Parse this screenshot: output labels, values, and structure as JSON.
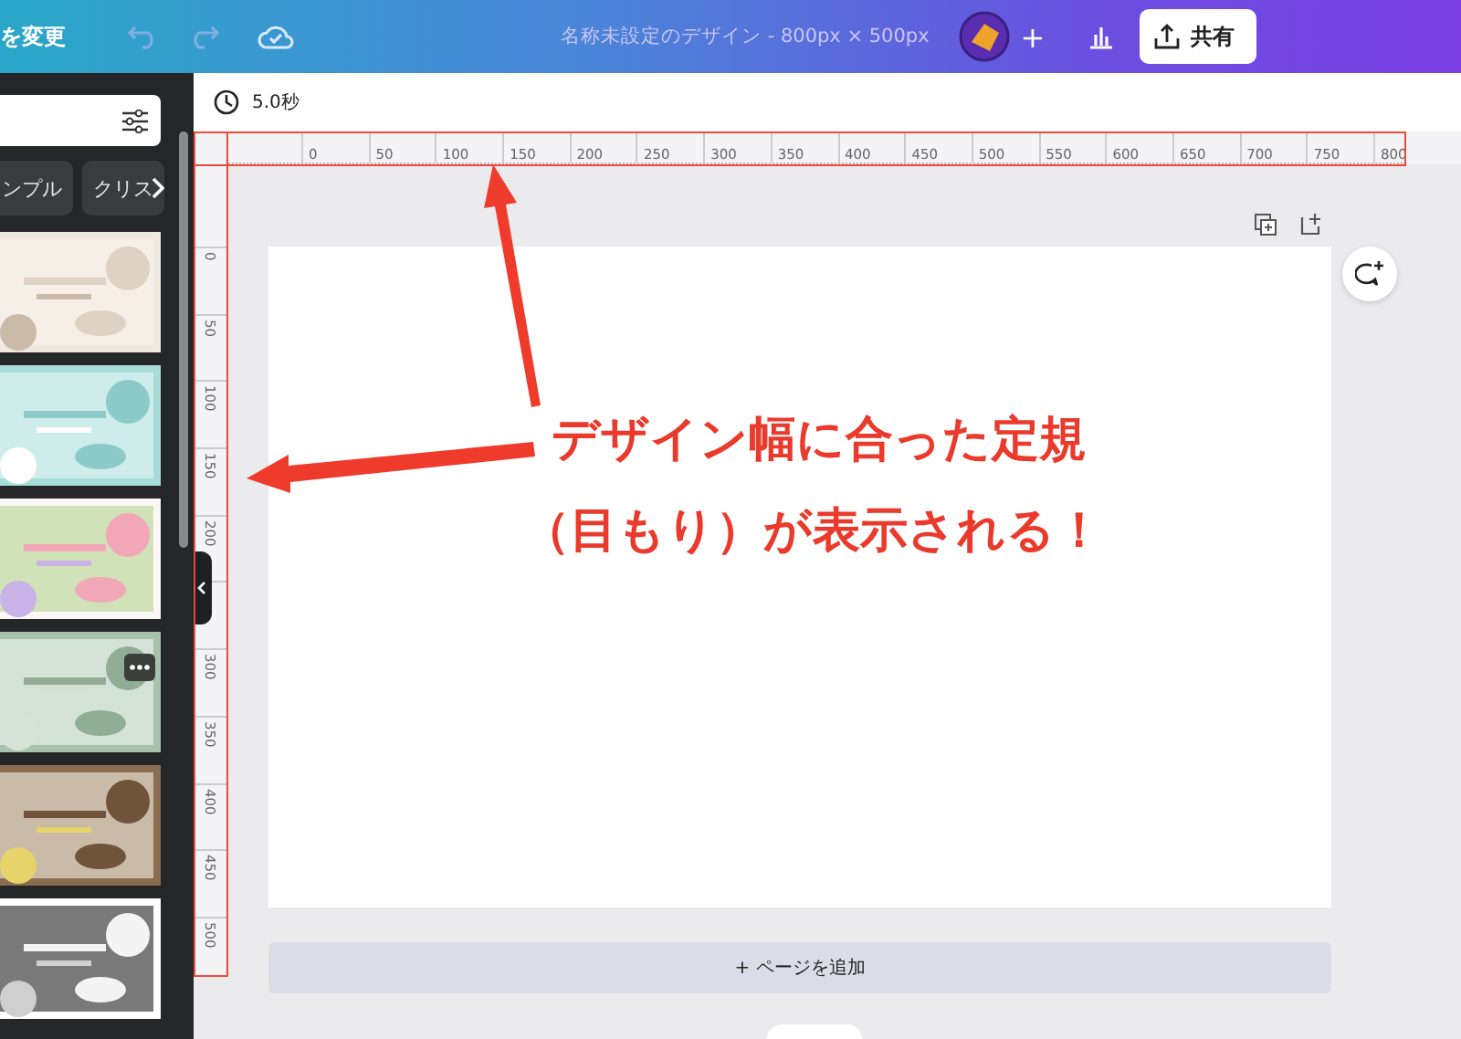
{
  "toolbar": {
    "menu_text": "を変更",
    "title": "名称未設定のデザイン - 800px × 500px",
    "add_button": "+",
    "share_button": "共有"
  },
  "side_panel": {
    "chips": [
      {
        "label": "ンプル"
      },
      {
        "label": "クリス"
      }
    ]
  },
  "timing": "5.0秒",
  "horizontal_ruler": {
    "labels": [
      "0",
      "50",
      "100",
      "150",
      "200",
      "250",
      "300",
      "350",
      "400",
      "450",
      "500",
      "550",
      "600",
      "650",
      "700",
      "750",
      "800"
    ]
  },
  "vertical_ruler": {
    "labels_above_handle": [
      "0",
      "50",
      "100",
      "150",
      "200"
    ],
    "labels_below_handle": [
      "300",
      "350",
      "400",
      "450",
      "500"
    ]
  },
  "add_page_button": "+ ページを追加",
  "annotation": {
    "lines": [
      "デザイン幅に合った定規",
      "（目もり）が表示される！"
    ]
  }
}
